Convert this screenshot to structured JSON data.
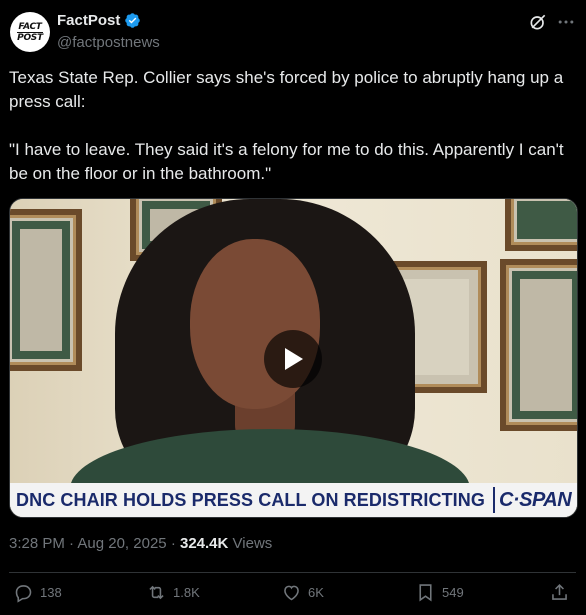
{
  "author": {
    "name": "FactPost",
    "handle": "@factpostnews",
    "avatar_text": [
      "FACT",
      "POST"
    ],
    "verified": true
  },
  "tweet": {
    "text": "Texas State Rep. Collier says she's forced by police to abruptly hang up a press call:\n\n\"I have to leave. They said it's a felony for me to do this. Apparently I can't be on the floor or in the bathroom.\""
  },
  "media": {
    "type": "video",
    "chyron": "DNC CHAIR HOLDS PRESS CALL ON REDISTRICTING",
    "brand": "C·SPAN"
  },
  "meta": {
    "time": "3:28 PM",
    "date": "Aug 20, 2025",
    "views_count": "324.4K",
    "views_label": "Views",
    "sep": "·"
  },
  "actions": {
    "replies": "138",
    "reposts": "1.8K",
    "likes": "6K",
    "bookmarks": "549"
  },
  "colors": {
    "background": "#000000",
    "text": "#e7e9ea",
    "muted": "#71767b",
    "verified": "#1d9bf0"
  }
}
